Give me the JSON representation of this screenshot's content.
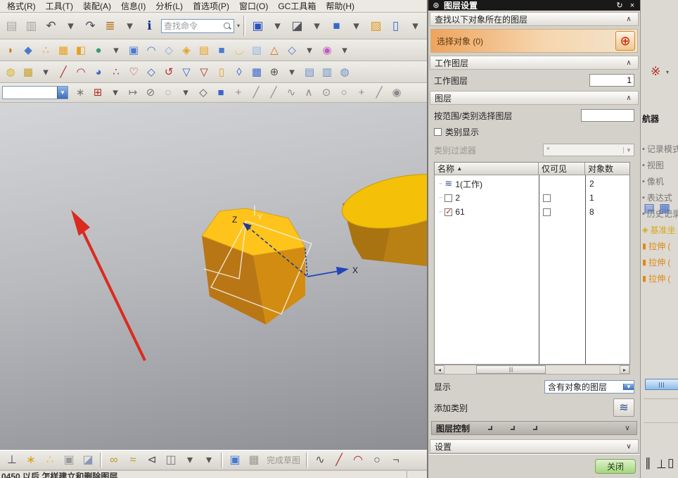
{
  "window": {
    "menu_items": [
      {
        "name": "menu-format",
        "label": "格式(R)"
      },
      {
        "name": "menu-tools",
        "label": "工具(T)"
      },
      {
        "name": "menu-assembly",
        "label": "装配(A)"
      },
      {
        "name": "menu-information",
        "label": "信息(I)"
      },
      {
        "name": "menu-analysis",
        "label": "分析(L)"
      },
      {
        "name": "menu-preferences",
        "label": "首选项(P)"
      },
      {
        "name": "menu-window",
        "label": "窗口(O)"
      },
      {
        "name": "menu-gc-toolbox",
        "label": "GC工具箱"
      },
      {
        "name": "menu-help",
        "label": "帮助(H)"
      }
    ]
  },
  "find_command": {
    "placeholder": "查找命令"
  },
  "selection_combo": {
    "value": ""
  },
  "toolbar_row1a": [
    {
      "name": "copy-icon",
      "glyph": "▤",
      "color": "#a8a69e"
    },
    {
      "name": "paste-icon",
      "glyph": "▥",
      "color": "#a8a69e"
    },
    {
      "name": "undo-icon",
      "glyph": "↶",
      "color": "#4a4a52"
    },
    {
      "name": "undo-caret",
      "glyph": "▾",
      "color": "#555"
    },
    {
      "name": "redo-icon",
      "glyph": "↷",
      "color": "#4a4a52"
    },
    {
      "name": "layer-list-icon",
      "glyph": "≣",
      "color": "#b06a10"
    },
    {
      "name": "layer-list-caret",
      "glyph": "▾",
      "color": "#555"
    },
    {
      "name": "info-window-icon",
      "glyph": "ℹ",
      "color": "#17338f"
    }
  ],
  "toolbar_row1b": [
    {
      "name": "fit-view-icon",
      "glyph": "▣",
      "color": "#2a52c0"
    },
    {
      "name": "fit-view-caret",
      "glyph": "▾",
      "color": "#555"
    },
    {
      "name": "orient-view-icon",
      "glyph": "◪",
      "color": "#55565c"
    },
    {
      "name": "orient-view-caret",
      "glyph": "▾",
      "color": "#555"
    },
    {
      "name": "isometric-cube-icon",
      "glyph": "■",
      "color": "#3a66cc"
    },
    {
      "name": "cube-caret",
      "glyph": "▾",
      "color": "#555"
    },
    {
      "name": "open-folder-icon",
      "glyph": "▨",
      "color": "#e0991c"
    },
    {
      "name": "window-icon",
      "glyph": "▯",
      "color": "#3a66cc"
    },
    {
      "name": "window-caret",
      "glyph": "▾",
      "color": "#555"
    }
  ],
  "toolbar_row2": [
    {
      "name": "revolve-icon",
      "glyph": "◗",
      "color": "#d07818"
    },
    {
      "name": "extrude-icon",
      "glyph": "◆",
      "color": "#4a7ad0"
    },
    {
      "name": "pattern-feature-icon",
      "glyph": "∴",
      "color": "#e8a01c"
    },
    {
      "name": "pattern-geometry-icon",
      "glyph": "▦",
      "color": "#e8a01c"
    },
    {
      "name": "unite-icon",
      "glyph": "◧",
      "color": "#e8a01c"
    },
    {
      "name": "sketch-icon",
      "glyph": "●",
      "color": "#3a9a70"
    },
    {
      "name": "sketch-caret",
      "glyph": "▾",
      "color": "#555"
    },
    {
      "name": "block-icon",
      "glyph": "▣",
      "color": "#4a7ad0"
    },
    {
      "name": "freeform-icon",
      "glyph": "◠",
      "color": "#4a7ad0"
    },
    {
      "name": "split-body-icon",
      "glyph": "◇",
      "color": "#8aa8d8"
    },
    {
      "name": "trim-body-icon",
      "glyph": "◈",
      "color": "#e8a01c"
    },
    {
      "name": "shell-icon",
      "glyph": "▤",
      "color": "#e8a01c"
    },
    {
      "name": "hole-icon",
      "glyph": "■",
      "color": "#4a7ad0"
    },
    {
      "name": "sheet-icon",
      "glyph": "◡",
      "color": "#e8c040"
    },
    {
      "name": "sweep-icon",
      "glyph": "▧",
      "color": "#9ab8e0"
    },
    {
      "name": "pyramid-icon",
      "glyph": "△",
      "color": "#e06a20"
    },
    {
      "name": "wireframe-cube-icon",
      "glyph": "◇",
      "color": "#4a7ad0"
    },
    {
      "name": "more-features-caret",
      "glyph": "▾",
      "color": "#555"
    },
    {
      "name": "move-object-icon",
      "glyph": "◉",
      "color": "#c05ac0"
    },
    {
      "name": "move-caret",
      "glyph": "▾",
      "color": "#555"
    }
  ],
  "toolbar_row3": [
    {
      "name": "part-family-icon",
      "glyph": "◍",
      "color": "#d8b020"
    },
    {
      "name": "annotation-icon",
      "glyph": "▩",
      "color": "#c8a030"
    },
    {
      "name": "annotation-caret",
      "glyph": "▾",
      "color": "#555"
    },
    {
      "name": "line-curve-icon",
      "glyph": "╱",
      "color": "#b03030"
    },
    {
      "name": "arc-curve-icon",
      "glyph": "◠",
      "color": "#b03030"
    },
    {
      "name": "studio-surface-icon",
      "glyph": "◕",
      "color": "#3a66cc"
    },
    {
      "name": "point-set-icon",
      "glyph": "∴",
      "color": "#8a4040"
    },
    {
      "name": "heart-profile-icon",
      "glyph": "♡",
      "color": "#b03030"
    },
    {
      "name": "sheet-trim-icon",
      "glyph": "◇",
      "color": "#3a66cc"
    },
    {
      "name": "curl-icon",
      "glyph": "↺",
      "color": "#b03030"
    },
    {
      "name": "trim-sheet-icon",
      "glyph": "▽",
      "color": "#3a66cc"
    },
    {
      "name": "offset-sheet-icon",
      "glyph": "▽",
      "color": "#b03030"
    },
    {
      "name": "sheet-body-icon",
      "glyph": "▯",
      "color": "#e8a01c"
    },
    {
      "name": "swap-face-icon",
      "glyph": "◊",
      "color": "#3a66cc"
    },
    {
      "name": "grid-surface-icon",
      "glyph": "▦",
      "color": "#3a66cc"
    },
    {
      "name": "normal-arrow-icon",
      "glyph": "⊕",
      "color": "#555"
    },
    {
      "name": "surface-caret",
      "glyph": "▾",
      "color": "#555"
    },
    {
      "name": "ruled-surface-icon",
      "glyph": "▤",
      "color": "#6a8ac8"
    },
    {
      "name": "through-curves-icon",
      "glyph": "▥",
      "color": "#6a8ac8"
    },
    {
      "name": "swept-icon",
      "glyph": "◍",
      "color": "#6a8ac8"
    }
  ],
  "toolbar_row4": [
    {
      "name": "select-scope-icon",
      "glyph": "∗",
      "color": "#777"
    },
    {
      "name": "snap-point-icon",
      "glyph": "⊞",
      "color": "#b03020"
    },
    {
      "name": "snap-caret",
      "glyph": "▾",
      "color": "#555"
    },
    {
      "name": "snap-end-icon",
      "glyph": "↦",
      "color": "#777"
    },
    {
      "name": "snap-mid-icon",
      "glyph": "⊘",
      "color": "#777"
    },
    {
      "name": "lasso-icon",
      "glyph": "◌",
      "color": "#777"
    },
    {
      "name": "lasso-caret",
      "glyph": "▾",
      "color": "#555"
    },
    {
      "name": "dice-icon",
      "glyph": "◇",
      "color": "#555"
    },
    {
      "name": "solid-box-icon",
      "glyph": "■",
      "color": "#3a66cc"
    },
    {
      "name": "snap-move-icon",
      "glyph": "+",
      "color": "#8a8a8a"
    },
    {
      "name": "snap-line1-icon",
      "glyph": "╱",
      "color": "#8a8a8a"
    },
    {
      "name": "snap-line2-icon",
      "glyph": "╱",
      "color": "#8a8a8a"
    },
    {
      "name": "snap-spline-icon",
      "glyph": "∿",
      "color": "#8a8a8a"
    },
    {
      "name": "snap-vertex-icon",
      "glyph": "∧",
      "color": "#8a8a8a"
    },
    {
      "name": "snap-center-icon",
      "glyph": "⊙",
      "color": "#8a8a8a"
    },
    {
      "name": "snap-circle-icon",
      "glyph": "○",
      "color": "#8a8a8a"
    },
    {
      "name": "snap-plus-icon",
      "glyph": "+",
      "color": "#8a8a8a"
    },
    {
      "name": "snap-diag-icon",
      "glyph": "╱",
      "color": "#8a8a8a"
    },
    {
      "name": "snap-point2-icon",
      "glyph": "◉",
      "color": "#8a8a8a"
    }
  ],
  "bottom_toolbar_a": [
    {
      "name": "datum-plane-icon",
      "glyph": "⊥",
      "color": "#445"
    },
    {
      "name": "key-icon",
      "glyph": "∗",
      "color": "#d8a018"
    },
    {
      "name": "balls-icon",
      "glyph": "∴",
      "color": "#e8b820"
    },
    {
      "name": "steps-icon",
      "glyph": "▣",
      "color": "#999"
    },
    {
      "name": "cube-brush-icon",
      "glyph": "◪",
      "color": "#8898b8"
    }
  ],
  "bottom_toolbar_b": [
    {
      "name": "chain-icon",
      "glyph": "∞",
      "color": "#c09a20"
    },
    {
      "name": "brush-chain-icon",
      "glyph": "≈",
      "color": "#c09a20"
    },
    {
      "name": "show-info-icon",
      "glyph": "⊲",
      "color": "#555"
    },
    {
      "name": "cubes-icon",
      "glyph": "◫",
      "color": "#777"
    },
    {
      "name": "cubes-caret",
      "glyph": "▾",
      "color": "#555"
    },
    {
      "name": "more-caret",
      "glyph": "▾",
      "color": "#555"
    }
  ],
  "bottom_toolbar_c": [
    {
      "name": "new-sketch-icon",
      "glyph": "▣",
      "color": "#4a7ad0"
    },
    {
      "name": "finish-sketch-icon",
      "glyph": "▦",
      "color": "#9a9890"
    }
  ],
  "bottom_toolbar_d": [
    {
      "name": "spline-icon",
      "glyph": "∿",
      "color": "#555"
    },
    {
      "name": "sketch-line-icon",
      "glyph": "╱",
      "color": "#b03030"
    },
    {
      "name": "sketch-arc-icon",
      "glyph": "◠",
      "color": "#b03030"
    },
    {
      "name": "sketch-circle-icon",
      "glyph": "○",
      "color": "#555"
    },
    {
      "name": "sketch-corner-icon",
      "glyph": "¬",
      "color": "#555"
    }
  ],
  "finish_sketch_label": "完成草图",
  "status_text": "0450 以后 怎样建立和删除图层",
  "viewport": {
    "axis_x": "X",
    "axis_y": "Y",
    "axis_z": "Z"
  },
  "dialog": {
    "title": "图层设置",
    "titlebar_icons": [
      {
        "name": "dialog-gear-icon",
        "glyph": "⊛"
      },
      {
        "name": "dialog-reset-icon",
        "glyph": "↻"
      },
      {
        "name": "dialog-close-icon",
        "glyph": "×"
      }
    ],
    "find_section": "查找以下对象所在的图层",
    "select_object": "选择对象 (0)",
    "work_layer_section": "工作图层",
    "work_layer_label": "工作图层",
    "work_layer_value": "1",
    "layer_section": "图层",
    "range_label": "按范围/类别选择图层",
    "range_value": "",
    "category_display": "类别显示",
    "category_display_checked": false,
    "category_filter_label": "类别过滤器",
    "category_filter_value": "*",
    "table": {
      "columns": [
        "名称",
        "仅可见",
        "对象数"
      ],
      "sort_icon": "▲",
      "rows": [
        {
          "name": "1(工作)",
          "layer_checked": null,
          "visible_only": null,
          "count": "2"
        },
        {
          "name": "2",
          "layer_checked": false,
          "visible_only": false,
          "count": "1"
        },
        {
          "name": "61",
          "layer_checked": true,
          "visible_only": false,
          "count": "8"
        }
      ]
    },
    "show_label": "显示",
    "show_value": "含有对象的图层",
    "add_category_label": "添加类别",
    "add_category_icon": "≋",
    "layer_control_label": "图层控制",
    "settings_label": "设置",
    "close_label": "关闭",
    "colors": {
      "selection_row": "#eea45e",
      "close_button": "#a5d57e",
      "titlebar": "#191919",
      "check_red": "#c01810"
    }
  },
  "navigator": {
    "header_fragment": "航器",
    "items": [
      {
        "name": "navigator-item-history-mode",
        "glyph": "▪",
        "color": "#777",
        "label": "记录模式"
      },
      {
        "name": "navigator-item-model-views",
        "glyph": "▪",
        "color": "#777",
        "label": "视图"
      },
      {
        "name": "navigator-item-cameras",
        "glyph": "▪",
        "color": "#777",
        "label": "像机"
      },
      {
        "name": "navigator-item-expressions",
        "glyph": "▪",
        "color": "#777",
        "label": "表达式"
      },
      {
        "name": "navigator-item-history",
        "glyph": "▪",
        "color": "#777",
        "label": "历史记录"
      },
      {
        "name": "navigator-item-datum-csys",
        "glyph": "◈",
        "color": "#d8a818",
        "label": "基准坐"
      },
      {
        "name": "navigator-item-extrude-1",
        "glyph": "▮",
        "color": "#e08818",
        "label": "拉伸 ("
      },
      {
        "name": "navigator-item-extrude-2",
        "glyph": "▮",
        "color": "#e08818",
        "label": "拉伸 ("
      },
      {
        "name": "navigator-item-extrude-3",
        "glyph": "▮",
        "color": "#e08818",
        "label": "拉伸 ("
      }
    ],
    "scroll_thumb_glyph": "|||"
  },
  "right_strip": {
    "icons_top": [
      {
        "name": "constraint-icon",
        "glyph": "※",
        "color": "#b03020"
      },
      {
        "name": "constraint-caret",
        "glyph": "▾",
        "color": "#555"
      }
    ],
    "icons_mid": [
      {
        "name": "sheet-doc-icon",
        "glyph": "▤",
        "color": "#3a66cc"
      },
      {
        "name": "table-grid-icon",
        "glyph": "▦",
        "color": "#3a66cc"
      }
    ],
    "icons_bottom": [
      {
        "name": "parallel-icon",
        "glyph": "∥",
        "color": "#8a8a8a"
      },
      {
        "name": "perpendicular-icon",
        "glyph": "⊥",
        "color": "#8a8a8a"
      },
      {
        "name": "frame-icon",
        "glyph": "▯",
        "color": "#8a8a8a"
      }
    ]
  }
}
